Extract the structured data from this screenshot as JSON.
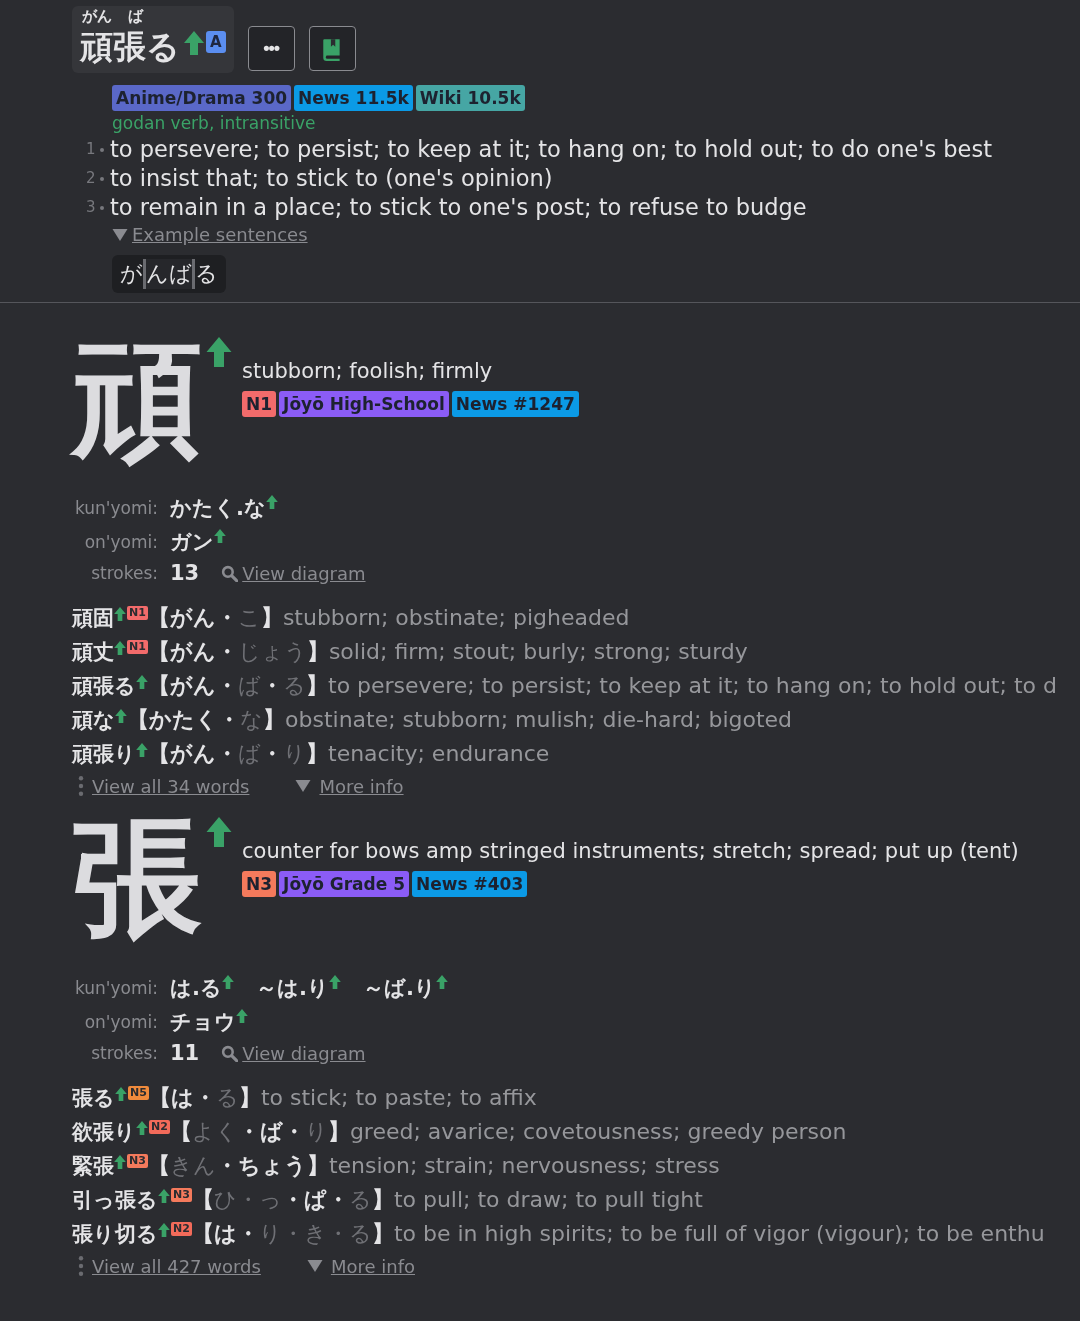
{
  "entry": {
    "furigana": [
      "がん",
      "ば"
    ],
    "word": "頑張る",
    "badge": "A",
    "more_button": "•••",
    "tags": [
      {
        "label": "Anime/Drama 300",
        "color": "#5a68c8"
      },
      {
        "label": "News 11.5k",
        "color": "#0b9ae6"
      },
      {
        "label": "Wiki 10.5k",
        "color": "#46a6a4"
      }
    ],
    "part_of_speech": "godan verb, intransitive",
    "senses": [
      {
        "number": "1",
        "text": "to persevere; to persist; to keep at it; to hang on; to hold out; to do one's best"
      },
      {
        "number": "2",
        "text": "to insist that; to stick to (one's opinion)"
      },
      {
        "number": "3",
        "text": "to remain in a place; to stick to one's post; to refuse to budge"
      }
    ],
    "examples_link": "Example sentences",
    "kana": [
      {
        "text": "が",
        "selected": false
      },
      {
        "text": "んば",
        "selected": true
      },
      {
        "text": "る",
        "selected": false
      }
    ]
  },
  "kanji": [
    {
      "character": "頑",
      "meaning": "stubborn; foolish; firmly",
      "tags": [
        {
          "label": "N1",
          "color": "#f26b6b"
        },
        {
          "label": "Jōyō High-School",
          "color": "#8b5cf6"
        },
        {
          "label": "News #1247",
          "color": "#0b9ae6"
        }
      ],
      "kun_label": "kun'yomi:",
      "kun": [
        "かたく.な"
      ],
      "on_label": "on'yomi:",
      "on": [
        "ガン"
      ],
      "strokes_label": "strokes:",
      "strokes": "13",
      "diagram_link": "View diagram",
      "words": [
        {
          "word": "頑固",
          "jlpt": "N1",
          "color": "#f26b6b",
          "reading": [
            {
              "text": "【がん・",
              "lit": true
            },
            {
              "text": "こ",
              "lit": false
            },
            {
              "text": "】",
              "lit": true
            }
          ],
          "meaning": "stubborn; obstinate; pigheaded"
        },
        {
          "word": "頑丈",
          "jlpt": "N1",
          "color": "#f26b6b",
          "reading": [
            {
              "text": "【がん・",
              "lit": true
            },
            {
              "text": "じょう",
              "lit": false
            },
            {
              "text": "】",
              "lit": true
            }
          ],
          "meaning": "solid; firm; stout; burly; strong; sturdy"
        },
        {
          "word": "頑張る",
          "reading": [
            {
              "text": "【がん・",
              "lit": true
            },
            {
              "text": "ば",
              "lit": false
            },
            {
              "text": "・",
              "lit": true
            },
            {
              "text": "る",
              "lit": false
            },
            {
              "text": "】",
              "lit": true
            }
          ],
          "meaning": "to persevere; to persist; to keep at it; to hang on; to hold out; to d"
        },
        {
          "word": "頑な",
          "reading": [
            {
              "text": "【かたく・",
              "lit": true
            },
            {
              "text": "な",
              "lit": false
            },
            {
              "text": "】",
              "lit": true
            }
          ],
          "meaning": "obstinate; stubborn; mulish; die-hard; bigoted"
        },
        {
          "word": "頑張り",
          "reading": [
            {
              "text": "【がん・",
              "lit": true
            },
            {
              "text": "ば",
              "lit": false
            },
            {
              "text": "・",
              "lit": true
            },
            {
              "text": "り",
              "lit": false
            },
            {
              "text": "】",
              "lit": true
            }
          ],
          "meaning": "tenacity; endurance"
        }
      ],
      "view_all": "View all 34 words",
      "more_info": "More info"
    },
    {
      "character": "張",
      "meaning": "counter for bows amp stringed instruments; stretch; spread; put up (tent)",
      "tags": [
        {
          "label": "N3",
          "color": "#f47a5c"
        },
        {
          "label": "Jōyō Grade 5",
          "color": "#8b5cf6"
        },
        {
          "label": "News #403",
          "color": "#0b9ae6"
        }
      ],
      "kun_label": "kun'yomi:",
      "kun": [
        "は.る",
        "～は.り",
        "～ば.り"
      ],
      "on_label": "on'yomi:",
      "on": [
        "チョウ"
      ],
      "strokes_label": "strokes:",
      "strokes": "11",
      "diagram_link": "View diagram",
      "words": [
        {
          "word": "張る",
          "jlpt": "N5",
          "color": "#ef8a3c",
          "reading": [
            {
              "text": "【は・",
              "lit": true
            },
            {
              "text": "る",
              "lit": false
            },
            {
              "text": "】",
              "lit": true
            }
          ],
          "meaning": "to stick; to paste; to affix"
        },
        {
          "word": "欲張り",
          "jlpt": "N2",
          "color": "#f26b5a",
          "reading": [
            {
              "text": "【",
              "lit": true
            },
            {
              "text": "よく",
              "lit": false
            },
            {
              "text": "・ば・",
              "lit": true
            },
            {
              "text": "り",
              "lit": false
            },
            {
              "text": "】",
              "lit": true
            }
          ],
          "meaning": "greed; avarice; covetousness; greedy person"
        },
        {
          "word": "緊張",
          "jlpt": "N3",
          "color": "#f47a5c",
          "reading": [
            {
              "text": "【",
              "lit": true
            },
            {
              "text": "きん",
              "lit": false
            },
            {
              "text": "・ちょう】",
              "lit": true
            }
          ],
          "meaning": "tension; strain; nervousness; stress"
        },
        {
          "word": "引っ張る",
          "jlpt": "N3",
          "color": "#f47a5c",
          "reading": [
            {
              "text": "【",
              "lit": true
            },
            {
              "text": "ひ・っ",
              "lit": false
            },
            {
              "text": "・ぱ・",
              "lit": true
            },
            {
              "text": "る",
              "lit": false
            },
            {
              "text": "】",
              "lit": true
            }
          ],
          "meaning": "to pull; to draw; to pull tight"
        },
        {
          "word": "張り切る",
          "jlpt": "N2",
          "color": "#f26b5a",
          "reading": [
            {
              "text": "【は・",
              "lit": true
            },
            {
              "text": "り・き・る",
              "lit": false
            },
            {
              "text": "】",
              "lit": true
            }
          ],
          "meaning": "to be in high spirits; to be full of vigor (vigour); to be enthu"
        }
      ],
      "view_all": "View all 427 words",
      "more_info": "More info"
    }
  ]
}
